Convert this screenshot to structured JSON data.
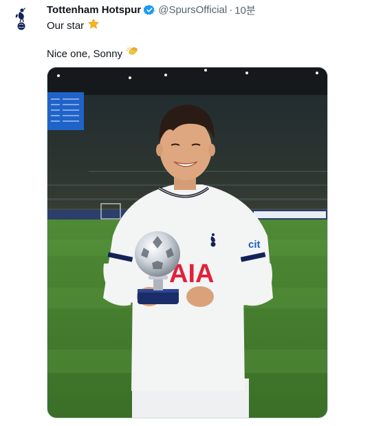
{
  "tweet": {
    "author_name": "Tottenham Hotspur",
    "handle": "@SpursOfficial",
    "separator": "·",
    "time_ago": "10분",
    "line1": "Our star",
    "line1_emoji": "star-emoji",
    "line2": "Nice one, Sonny",
    "line2_emoji": "clapping-hands-emoji",
    "verified": true
  },
  "media": {
    "kind": "photo",
    "shirt_sponsor_visible": "AIA",
    "shirt_partner_visible": "cit"
  },
  "colors": {
    "verified_badge": "#1d9bf0",
    "handle_text": "#536471",
    "spurs_navy": "#132257",
    "pitch_green": "#3f7f2f",
    "star_gold": "#f5b51f",
    "sponsor_red": "#e1213b"
  }
}
